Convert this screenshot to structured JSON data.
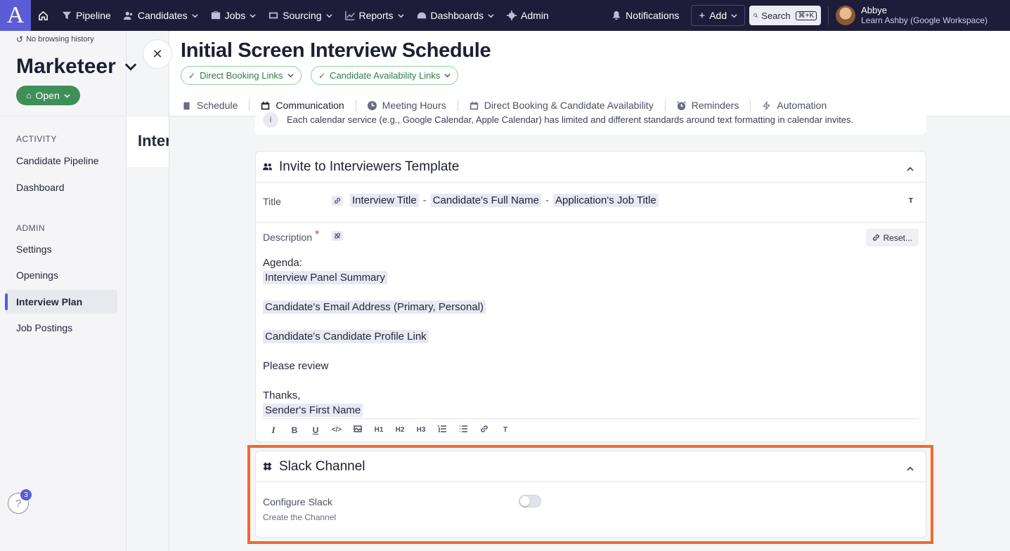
{
  "topnav": {
    "logo_letter": "A",
    "items": [
      {
        "label": "Pipeline",
        "icon": "filter-icon"
      },
      {
        "label": "Candidates",
        "icon": "people-icon"
      },
      {
        "label": "Jobs",
        "icon": "briefcase-icon"
      },
      {
        "label": "Sourcing",
        "icon": "sourcing-icon"
      },
      {
        "label": "Reports",
        "icon": "chart-icon"
      },
      {
        "label": "Dashboards",
        "icon": "gauge-icon"
      },
      {
        "label": "Admin",
        "icon": "gear-icon"
      }
    ],
    "notifications_label": "Notifications",
    "add_label": "Add",
    "search_label": "Search",
    "search_shortcut": "⌘+K",
    "user_name": "Abbye",
    "user_org": "Learn Ashby (Google Workspace)"
  },
  "sidebar": {
    "history": "No browsing history",
    "org_title": "Marketeer",
    "status_label": "Open",
    "sections": [
      {
        "label": "ACTIVITY",
        "items": [
          "Candidate Pipeline",
          "Dashboard"
        ]
      },
      {
        "label": "ADMIN",
        "items": [
          "Settings",
          "Openings",
          "Interview Plan",
          "Job Postings"
        ]
      }
    ],
    "active_item": "Interview Plan",
    "help_badge": "3"
  },
  "background": {
    "title_fragment": "Inter"
  },
  "drawer": {
    "title": "Initial Screen Interview Schedule",
    "pills": [
      "Direct Booking Links",
      "Candidate Availability Links"
    ],
    "tabs": [
      {
        "label": "Schedule",
        "icon": "clipboard-icon"
      },
      {
        "label": "Communication",
        "icon": "calendar-icon"
      },
      {
        "label": "Meeting Hours",
        "icon": "clock-icon"
      },
      {
        "label": "Direct Booking & Candidate Availability",
        "icon": "calendar-icon"
      },
      {
        "label": "Reminders",
        "icon": "alarm-icon"
      },
      {
        "label": "Automation",
        "icon": "bolt-icon"
      }
    ],
    "active_tab": "Communication",
    "note": {
      "icon_letter": "i",
      "text": "Each calendar service (e.g., Google Calendar, Apple Calendar) has limited and different standards around text formatting in calendar invites."
    },
    "invite_card": {
      "title": "Invite to Interviewers Template",
      "title_label": "Title",
      "title_tokens": [
        "Interview Title",
        "Candidate's Full Name",
        "Application's Job Title"
      ],
      "title_separator": "-",
      "text_format_icon": "T",
      "description_label": "Description",
      "required_mark": "*",
      "reset_label": "Reset...",
      "description_lines": [
        {
          "text": "Agenda:",
          "chip": false
        },
        {
          "text": "Interview Panel Summary",
          "chip": true
        },
        {
          "text": "Candidate's Email Address (Primary, Personal)",
          "chip": true
        },
        {
          "text": "Candidate's Candidate Profile Link",
          "chip": true
        },
        {
          "text": "Please review",
          "chip": false
        },
        {
          "text": "Thanks,",
          "chip": false
        },
        {
          "text": "Sender's First Name",
          "chip": true
        }
      ],
      "toolbar": [
        "I",
        "B",
        "U",
        "</>",
        "img",
        "H1",
        "H2",
        "H3",
        "ol",
        "ul",
        "link",
        "T"
      ]
    },
    "slack_card": {
      "title": "Slack Channel",
      "configure_label": "Configure Slack",
      "sub_label": "Create the Channel",
      "toggle_on": false
    }
  },
  "colors": {
    "accent": "#5c5cd6",
    "nav_bg": "#1d1d3a",
    "open_green": "#3e8f58",
    "highlight": "#ef6b2c"
  }
}
